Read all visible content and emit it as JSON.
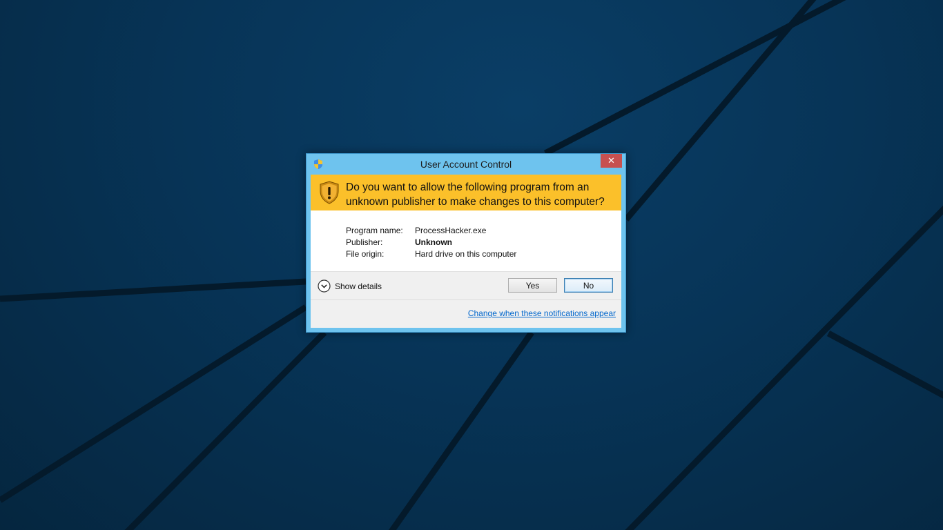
{
  "window": {
    "title": "User Account Control",
    "close_symbol": "✕",
    "icon": "uac-shield-icon"
  },
  "banner": {
    "question": "Do you want to allow the following program from an unknown publisher to make changes to this computer?",
    "icon": "warning-shield-icon",
    "color": "#fbc02a"
  },
  "info": {
    "program_name_label": "Program name:",
    "program_name": "ProcessHacker.exe",
    "publisher_label": "Publisher:",
    "publisher": "Unknown",
    "file_origin_label": "File origin:",
    "file_origin": "Hard drive on this computer"
  },
  "details": {
    "label": "Show details",
    "icon": "chevron-down-icon"
  },
  "buttons": {
    "yes": "Yes",
    "no": "No"
  },
  "link": {
    "text": "Change when these notifications appear"
  },
  "colors": {
    "window_frame": "#6ec3ee",
    "close_button": "#c75050",
    "link": "#0066cc"
  }
}
